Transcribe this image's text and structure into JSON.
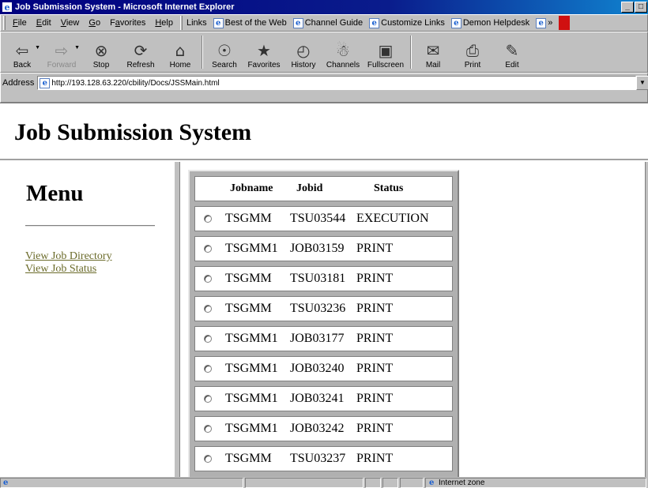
{
  "window": {
    "title": "Job Submission System - Microsoft Internet Explorer",
    "minimize": "_",
    "restore": "□"
  },
  "menu": [
    "File",
    "Edit",
    "View",
    "Go",
    "Favorites",
    "Help"
  ],
  "menu_underline": [
    "F",
    "E",
    "V",
    "G",
    "a",
    "H"
  ],
  "links": {
    "label": "Links",
    "items": [
      "Best of the Web",
      "Channel Guide",
      "Customize Links",
      "Demon Helpdesk"
    ],
    "overflow": "»"
  },
  "toolbar": {
    "buttons": [
      {
        "label": "Back",
        "icon": "back-arrow-icon",
        "glyph": "⇦",
        "enabled": true,
        "dropdown": true
      },
      {
        "label": "Forward",
        "icon": "forward-arrow-icon",
        "glyph": "⇨",
        "enabled": false,
        "dropdown": true
      },
      {
        "label": "Stop",
        "icon": "stop-icon",
        "glyph": "⊗",
        "enabled": true
      },
      {
        "label": "Refresh",
        "icon": "refresh-icon",
        "glyph": "⟳",
        "enabled": true
      },
      {
        "label": "Home",
        "icon": "home-icon",
        "glyph": "⌂",
        "enabled": true
      },
      {
        "label": "Search",
        "icon": "search-icon",
        "glyph": "☉",
        "enabled": true
      },
      {
        "label": "Favorites",
        "icon": "favorites-icon",
        "glyph": "★",
        "enabled": true
      },
      {
        "label": "History",
        "icon": "history-icon",
        "glyph": "◴",
        "enabled": true
      },
      {
        "label": "Channels",
        "icon": "channels-icon",
        "glyph": "☃",
        "enabled": true
      },
      {
        "label": "Fullscreen",
        "icon": "fullscreen-icon",
        "glyph": "▣",
        "enabled": true
      },
      {
        "label": "Mail",
        "icon": "mail-icon",
        "glyph": "✉",
        "enabled": true
      },
      {
        "label": "Print",
        "icon": "print-icon",
        "glyph": "⎙",
        "enabled": true
      },
      {
        "label": "Edit",
        "icon": "edit-icon",
        "glyph": "✎",
        "enabled": true
      }
    ]
  },
  "address": {
    "label": "Address",
    "url": "http://193.128.63.220/cbility/Docs/JSSMain.html"
  },
  "page": {
    "title": "Job Submission System",
    "menu_title": "Menu",
    "menu_links": [
      "View Job Directory",
      "View Job Status"
    ]
  },
  "jobs": {
    "headers": {
      "name": "Jobname",
      "id": "Jobid",
      "status": "Status"
    },
    "rows": [
      {
        "name": "TSGMM",
        "id": "TSU03544",
        "status": "EXECUTION"
      },
      {
        "name": "TSGMM1",
        "id": "JOB03159",
        "status": "PRINT"
      },
      {
        "name": "TSGMM",
        "id": "TSU03181",
        "status": "PRINT"
      },
      {
        "name": "TSGMM",
        "id": "TSU03236",
        "status": "PRINT"
      },
      {
        "name": "TSGMM1",
        "id": "JOB03177",
        "status": "PRINT"
      },
      {
        "name": "TSGMM1",
        "id": "JOB03240",
        "status": "PRINT"
      },
      {
        "name": "TSGMM1",
        "id": "JOB03241",
        "status": "PRINT"
      },
      {
        "name": "TSGMM1",
        "id": "JOB03242",
        "status": "PRINT"
      },
      {
        "name": "TSGMM",
        "id": "TSU03237",
        "status": "PRINT"
      }
    ]
  },
  "statusbar": {
    "zone": "Internet zone"
  },
  "colors": {
    "titlebar": "#000080",
    "visited_link": "#6b6b2a",
    "chrome": "#c0c0c0"
  }
}
